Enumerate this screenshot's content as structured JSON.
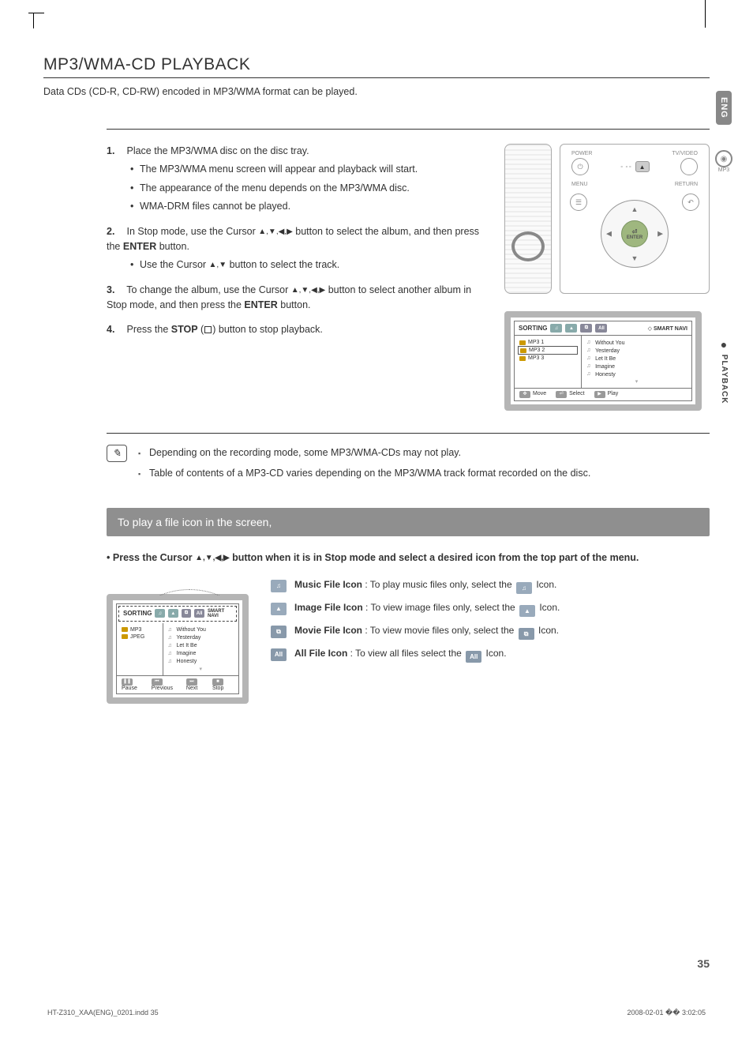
{
  "header": {
    "title": "MP3/WMA-CD PLAYBACK",
    "intro": "Data CDs (CD-R, CD-RW) encoded in MP3/WMA format can be played."
  },
  "side": {
    "lang": "ENG",
    "section_dot": "●",
    "section": "PLAYBACK",
    "disc_label": "MP3"
  },
  "steps": {
    "s1": {
      "text": "Place the MP3/WMA disc on the disc tray.",
      "b1": "The MP3/WMA menu screen will appear and playback will start.",
      "b2": "The appearance of the menu depends on the MP3/WMA disc.",
      "b3": "WMA-DRM files cannot be played."
    },
    "s2": {
      "lead": "In Stop mode, use the Cursor ",
      "tail": " button to select the album, and then press the ",
      "enter": "ENTER",
      "end": " button.",
      "b1a": "Use the Cursor ",
      "b1b": " button to select the track."
    },
    "s3": {
      "lead": "To change the album, use the Cursor ",
      "tail": " button to select another album in Stop mode, and then press the ",
      "enter": "ENTER",
      "end": " button."
    },
    "s4": {
      "lead": "Press the ",
      "stop": "STOP",
      "tail": " button to stop playback."
    }
  },
  "remote": {
    "power": "POWER",
    "tvvideo": "TV/VIDEO",
    "menu": "MENU",
    "return": "RETURN",
    "enter": "ENTER",
    "eject": "▲",
    "power_sym": "⏻"
  },
  "osd": {
    "sort": "SORTING",
    "smart": "SMART NAVI",
    "diamond": "◇",
    "folders": {
      "f1": "MP3 1",
      "f2": "MP3 2",
      "f3": "MP3 3"
    },
    "tracks": {
      "t1": "Without You",
      "t2": "Yesterday",
      "t3": "Let It Be",
      "t4": "Imagine",
      "t5": "Honesty"
    },
    "note_sym": "♫",
    "bot_move": "Move",
    "bot_select": "Select",
    "bot_play": "Play"
  },
  "notes": {
    "n1": "Depending on the recording mode, some MP3/WMA-CDs may not play.",
    "n2": "Table of contents of a MP3-CD varies depending on the MP3/WMA track format recorded on the disc."
  },
  "bar": {
    "title": "To play a file icon in the screen,"
  },
  "instruct": {
    "bullet": "•",
    "lead": "Press the Cursor ",
    "tail": " button when it is in Stop mode and select a desired icon from the top part of the menu."
  },
  "osd2": {
    "fold1": "MP3",
    "fold2": "JPEG",
    "bot_pause": "Pause",
    "bot_prev": "Previous",
    "bot_next": "Next",
    "bot_stop": "Stop"
  },
  "icons": {
    "music_glyph": "♫",
    "image_glyph": "▲",
    "movie_glyph": "⧉",
    "all_glyph": "All",
    "music": {
      "name": "Music File Icon",
      "desc": " : To play music files only, select the ",
      "end": " Icon."
    },
    "image": {
      "name": "Image File Icon",
      "desc": " : To view image files only, select the ",
      "end": " Icon."
    },
    "movie": {
      "name": "Movie File Icon",
      "desc": " : To view movie files only, select the ",
      "end": " Icon."
    },
    "all": {
      "name": "All File Icon",
      "desc": " : To view all files select the ",
      "end": " Icon."
    }
  },
  "page": {
    "number": "35",
    "footer_left": "HT-Z310_XAA(ENG)_0201.indd   35",
    "footer_right": "2008-02-01   �� 3:02:05"
  },
  "glyph": {
    "up": "▲",
    "down": "▼",
    "left": "◀",
    "right": "▶",
    "udlr": "▲,▼,◀,▶",
    "ud": "▲,▼"
  }
}
